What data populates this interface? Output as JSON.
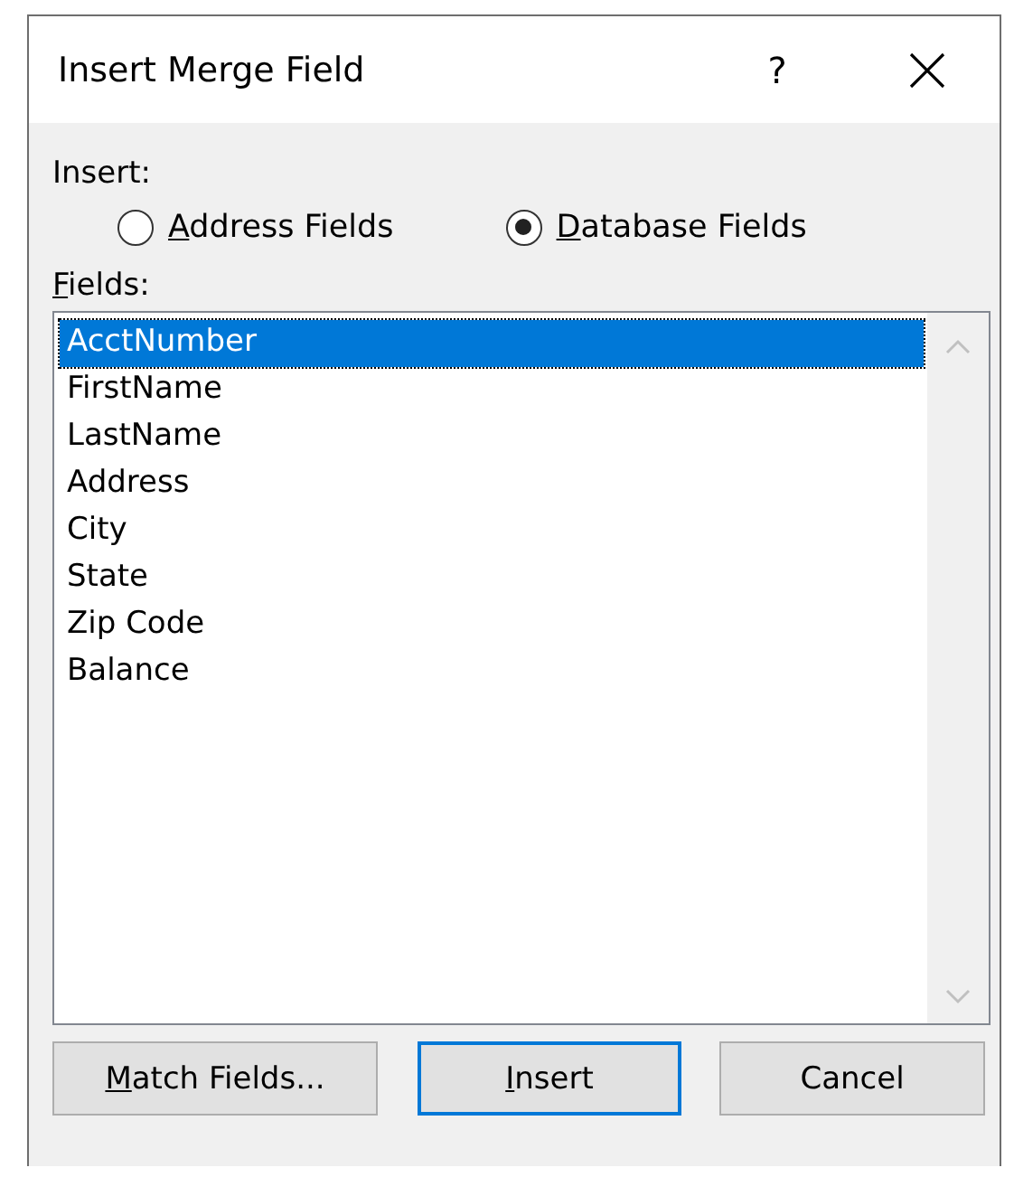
{
  "window": {
    "title": "Insert Merge Field",
    "help": "?"
  },
  "insert_group": {
    "label": "Insert:",
    "options": [
      {
        "label": "Address Fields",
        "mnemonic": true,
        "selected": false
      },
      {
        "label": "Database Fields",
        "mnemonic": true,
        "selected": true
      }
    ]
  },
  "fields_label": {
    "label": "Fields:",
    "mnemonic": true
  },
  "fields": [
    {
      "label": "AcctNumber",
      "selected": true
    },
    {
      "label": "FirstName",
      "selected": false
    },
    {
      "label": "LastName",
      "selected": false
    },
    {
      "label": "Address",
      "selected": false
    },
    {
      "label": "City",
      "selected": false
    },
    {
      "label": "State",
      "selected": false
    },
    {
      "label": "Zip Code",
      "selected": false
    },
    {
      "label": "Balance",
      "selected": false
    }
  ],
  "buttons": [
    {
      "label": "Match Fields...",
      "mnemonic": true,
      "default": false
    },
    {
      "label": "Insert",
      "mnemonic": true,
      "default": true
    },
    {
      "label": "Cancel",
      "mnemonic": false,
      "default": false
    }
  ]
}
